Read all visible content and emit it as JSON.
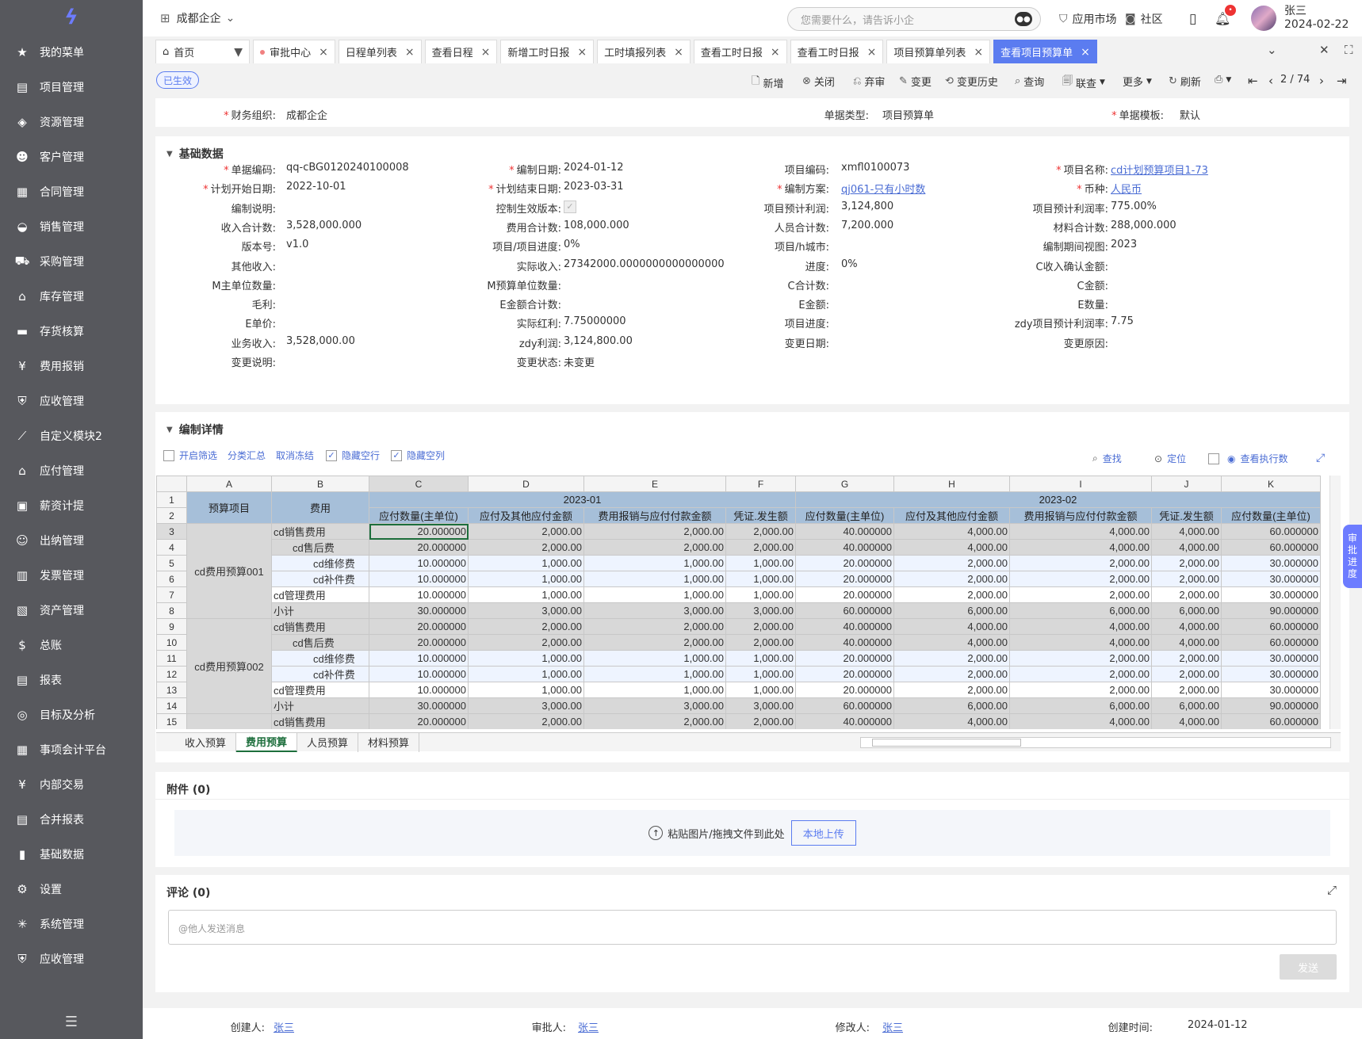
{
  "sidebar": {
    "items": [
      {
        "icon": "star-icon",
        "label": "我的菜单"
      },
      {
        "icon": "project-icon",
        "label": "项目管理"
      },
      {
        "icon": "layers-icon",
        "label": "资源管理"
      },
      {
        "icon": "customer-icon",
        "label": "客户管理"
      },
      {
        "icon": "contract-icon",
        "label": "合同管理"
      },
      {
        "icon": "sales-icon",
        "label": "销售管理"
      },
      {
        "icon": "cart-icon",
        "label": "采购管理"
      },
      {
        "icon": "warehouse-icon",
        "label": "库存管理"
      },
      {
        "icon": "inventory-icon",
        "label": "存货核算"
      },
      {
        "icon": "expense-icon",
        "label": "费用报销"
      },
      {
        "icon": "receivable-icon",
        "label": "应收管理"
      },
      {
        "icon": "chart-icon",
        "label": "自定义模块2"
      },
      {
        "icon": "payable-icon",
        "label": "应付管理"
      },
      {
        "icon": "salary-icon",
        "label": "薪资计提"
      },
      {
        "icon": "cashier-icon",
        "label": "出纳管理"
      },
      {
        "icon": "invoice-icon",
        "label": "发票管理"
      },
      {
        "icon": "asset-icon",
        "label": "资产管理"
      },
      {
        "icon": "ledger-icon",
        "label": "总账"
      },
      {
        "icon": "report-icon",
        "label": "报表"
      },
      {
        "icon": "target-icon",
        "label": "目标及分析"
      },
      {
        "icon": "grid-icon",
        "label": "事项会计平台"
      },
      {
        "icon": "exchange-icon",
        "label": "内部交易"
      },
      {
        "icon": "merge-report-icon",
        "label": "合并报表"
      },
      {
        "icon": "bar-chart-icon",
        "label": "基础数据"
      },
      {
        "icon": "gear-icon",
        "label": "设置"
      },
      {
        "icon": "system-icon",
        "label": "系统管理"
      },
      {
        "icon": "receivable-icon",
        "label": "应收管理"
      }
    ],
    "collapse_glyph": "☰"
  },
  "topbar": {
    "org": "成都企企",
    "search_placeholder": "您需要什么，请告诉小企",
    "app_market": "应用市场",
    "community": "社区",
    "user_name": "张三",
    "user_date": "2024-02-22",
    "notif_badge": "•"
  },
  "tabs": [
    {
      "label": "首页",
      "close": "▼"
    },
    {
      "label": "审批中心",
      "close": "×",
      "dot": true
    },
    {
      "label": "日程单列表",
      "close": "×"
    },
    {
      "label": "查看日程",
      "close": "×"
    },
    {
      "label": "新增工时日报",
      "close": "×"
    },
    {
      "label": "工时填报列表",
      "close": "×"
    },
    {
      "label": "查看工时日报",
      "close": "×"
    },
    {
      "label": "查看工时日报",
      "close": "×"
    },
    {
      "label": "项目预算单列表",
      "close": "×"
    },
    {
      "label": "查看项目预算单",
      "close": "×",
      "active": true
    }
  ],
  "toolbar": {
    "status": "已生效",
    "buttons": [
      "新增",
      "关闭",
      "弃审",
      "变更",
      "变更历史",
      "查询",
      "联查",
      "更多",
      "刷新"
    ],
    "pager": "2 / 74"
  },
  "header_fields": [
    {
      "label": "财务组织:",
      "value": "成都企企",
      "req": true
    },
    {
      "label": "单据类型:",
      "value": "项目预算单"
    },
    {
      "label": "单据模板:",
      "value": "默认",
      "req": true
    }
  ],
  "section_basic": "基础数据",
  "basic_fields": [
    [
      {
        "label": "单据编码:",
        "value": "qq-cBG0120240100008",
        "req": true
      },
      {
        "label": "编制日期:",
        "value": "2024-01-12",
        "req": true
      },
      {
        "label": "项目编码:",
        "value": "xmfl0100073"
      },
      {
        "label": "项目名称:",
        "value": "cd计划预算项目1-73",
        "req": true,
        "link": true
      }
    ],
    [
      {
        "label": "计划开始日期:",
        "value": "2022-10-01",
        "req": true
      },
      {
        "label": "计划结束日期:",
        "value": "2023-03-31",
        "req": true
      },
      {
        "label": "编制方案:",
        "value": "qj061-只有小时数",
        "req": true,
        "link": true
      },
      {
        "label": "币种:",
        "value": "人民币",
        "req": true,
        "link": true
      }
    ],
    [
      {
        "label": "编制说明:",
        "value": ""
      },
      {
        "label": "控制生效版本:",
        "value": "✓"
      },
      {
        "label": "项目预计利润:",
        "value": "3,124,800"
      },
      {
        "label": "项目预计利润率:",
        "value": "775.00%"
      }
    ],
    [
      {
        "label": "收入合计数:",
        "value": "3,528,000.000"
      },
      {
        "label": "费用合计数:",
        "value": "108,000.000"
      },
      {
        "label": "人员合计数:",
        "value": "7,200.000"
      },
      {
        "label": "材料合计数:",
        "value": "288,000.000"
      }
    ],
    [
      {
        "label": "版本号:",
        "value": "v1.0"
      },
      {
        "label": "项目/项目进度:",
        "value": "0%"
      },
      {
        "label": "项目/h城市:",
        "value": ""
      },
      {
        "label": "编制期间视图:",
        "value": "2023"
      }
    ],
    [
      {
        "label": "其他收入:",
        "value": ""
      },
      {
        "label": "实际收入:",
        "value": "27342000.0000000000000000"
      },
      {
        "label": "进度:",
        "value": "0%"
      },
      {
        "label": "C收入确认金额:",
        "value": ""
      }
    ],
    [
      {
        "label": "M主单位数量:",
        "value": ""
      },
      {
        "label": "M预算单位数量:",
        "value": ""
      },
      {
        "label": "C合计数:",
        "value": ""
      },
      {
        "label": "C金额:",
        "value": ""
      }
    ],
    [
      {
        "label": "毛利:",
        "value": ""
      },
      {
        "label": "E金额合计数:",
        "value": ""
      },
      {
        "label": "E金额:",
        "value": ""
      },
      {
        "label": "E数量:",
        "value": ""
      }
    ],
    [
      {
        "label": "E单价:",
        "value": ""
      },
      {
        "label": "实际红利:",
        "value": "7.75000000"
      },
      {
        "label": "项目进度:",
        "value": ""
      },
      {
        "label": "zdy项目预计利润率:",
        "value": "7.75"
      }
    ],
    [
      {
        "label": "业务收入:",
        "value": "3,528,000.00"
      },
      {
        "label": "zdy利润:",
        "value": "3,124,800.00"
      },
      {
        "label": "变更日期:",
        "value": ""
      },
      {
        "label": "变更原因:",
        "value": ""
      }
    ],
    [
      {
        "label": "变更说明:",
        "value": ""
      },
      {
        "label": "变更状态:",
        "value": "未变更"
      },
      {
        "label": "",
        "value": ""
      },
      {
        "label": "",
        "value": ""
      }
    ]
  ],
  "section_detail": "编制详情",
  "detail_options": [
    "开启筛选",
    "分类汇总",
    "取消冻结",
    "隐藏空行",
    "隐藏空列"
  ],
  "detail_tools": [
    "查找",
    "定位",
    "查看执行数"
  ],
  "sheet": {
    "col_letters": [
      "A",
      "B",
      "C",
      "D",
      "E",
      "F",
      "G",
      "H",
      "I",
      "J",
      "K"
    ],
    "header_a": "预算项目",
    "header_b": "费用",
    "period1": "2023-01",
    "period2": "2023-02",
    "sub_headers": [
      "应付数量(主单位)",
      "应付及其他应付金额",
      "费用报销与应付付款金额",
      "凭证.发生额",
      "应付数量(主单位)",
      "应付及其他应付金额",
      "费用报销与应付付款金额",
      "凭证.发生额",
      "应付数量(主单位)"
    ],
    "group1": "cd费用预算001",
    "group2": "cd费用预算002",
    "rows": [
      {
        "n": "3",
        "b": "cd销售费用",
        "cls": "gray",
        "v": [
          "20.000000",
          "2,000.00",
          "2,000.00",
          "2,000.00",
          "40.000000",
          "4,000.00",
          "4,000.00",
          "4,000.00",
          "60.000000"
        ]
      },
      {
        "n": "4",
        "b": "cd售后费",
        "cls": "gray",
        "v": [
          "20.000000",
          "2,000.00",
          "2,000.00",
          "2,000.00",
          "40.000000",
          "4,000.00",
          "4,000.00",
          "4,000.00",
          "60.000000"
        ]
      },
      {
        "n": "5",
        "b": "cd维修费",
        "cls": "light",
        "v": [
          "10.000000",
          "1,000.00",
          "1,000.00",
          "1,000.00",
          "20.000000",
          "2,000.00",
          "2,000.00",
          "2,000.00",
          "30.000000"
        ]
      },
      {
        "n": "6",
        "b": "cd补件费",
        "cls": "light",
        "v": [
          "10.000000",
          "1,000.00",
          "1,000.00",
          "1,000.00",
          "20.000000",
          "2,000.00",
          "2,000.00",
          "2,000.00",
          "30.000000"
        ]
      },
      {
        "n": "7",
        "b": "cd管理费用",
        "cls": "white",
        "v": [
          "10.000000",
          "1,000.00",
          "1,000.00",
          "1,000.00",
          "20.000000",
          "2,000.00",
          "2,000.00",
          "2,000.00",
          "30.000000"
        ]
      },
      {
        "n": "8",
        "b": "小计",
        "cls": "gray",
        "v": [
          "30.000000",
          "3,000.00",
          "3,000.00",
          "3,000.00",
          "60.000000",
          "6,000.00",
          "6,000.00",
          "6,000.00",
          "90.000000"
        ]
      },
      {
        "n": "9",
        "b": "cd销售费用",
        "cls": "gray",
        "v": [
          "20.000000",
          "2,000.00",
          "2,000.00",
          "2,000.00",
          "40.000000",
          "4,000.00",
          "4,000.00",
          "4,000.00",
          "60.000000"
        ]
      },
      {
        "n": "10",
        "b": "cd售后费",
        "cls": "gray",
        "v": [
          "20.000000",
          "2,000.00",
          "2,000.00",
          "2,000.00",
          "40.000000",
          "4,000.00",
          "4,000.00",
          "4,000.00",
          "60.000000"
        ]
      },
      {
        "n": "11",
        "b": "cd维修费",
        "cls": "light",
        "v": [
          "10.000000",
          "1,000.00",
          "1,000.00",
          "1,000.00",
          "20.000000",
          "2,000.00",
          "2,000.00",
          "2,000.00",
          "30.000000"
        ]
      },
      {
        "n": "12",
        "b": "cd补件费",
        "cls": "light",
        "v": [
          "10.000000",
          "1,000.00",
          "1,000.00",
          "1,000.00",
          "20.000000",
          "2,000.00",
          "2,000.00",
          "2,000.00",
          "30.000000"
        ]
      },
      {
        "n": "13",
        "b": "cd管理费用",
        "cls": "white",
        "v": [
          "10.000000",
          "1,000.00",
          "1,000.00",
          "1,000.00",
          "20.000000",
          "2,000.00",
          "2,000.00",
          "2,000.00",
          "30.000000"
        ]
      },
      {
        "n": "14",
        "b": "小计",
        "cls": "gray",
        "v": [
          "30.000000",
          "3,000.00",
          "3,000.00",
          "3,000.00",
          "60.000000",
          "6,000.00",
          "6,000.00",
          "6,000.00",
          "90.000000"
        ]
      },
      {
        "n": "15",
        "b": "cd销售费用",
        "cls": "gray",
        "v": [
          "20.000000",
          "2,000.00",
          "2,000.00",
          "2,000.00",
          "40.000000",
          "4,000.00",
          "4,000.00",
          "4,000.00",
          "60.000000"
        ]
      }
    ],
    "tabs": [
      "收入预算",
      "费用预算",
      "人员预算",
      "材料预算"
    ]
  },
  "attachments": {
    "title": "附件 (0)",
    "hint": "粘贴图片/拖拽文件到此处",
    "upload": "本地上传"
  },
  "comments": {
    "title": "评论 (0)",
    "placeholder": "@他人发送消息",
    "send": "发送"
  },
  "side_tab": [
    "审",
    "批",
    "进",
    "度"
  ],
  "footer": [
    {
      "label": "创建人:",
      "value": "张三"
    },
    {
      "label": "审批人:",
      "value": "张三"
    },
    {
      "label": "修改人:",
      "value": "张三"
    },
    {
      "label": "创建时间:",
      "value": "2024-01-12"
    }
  ]
}
